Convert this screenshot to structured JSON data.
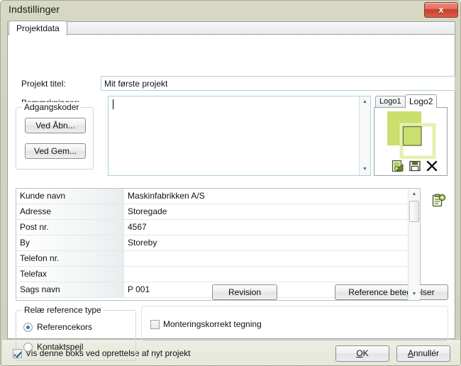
{
  "window": {
    "title": "Indstillinger",
    "close_label": "x",
    "close_icon": "close-icon"
  },
  "tabs": [
    {
      "label": "Projektdata",
      "active": true
    }
  ],
  "form": {
    "project_title_label": "Projekt titel:",
    "project_title_value": "Mit første projekt",
    "remarks_label": "Bemærkninger:",
    "remarks_value": ""
  },
  "passwords_group": {
    "title": "Adgangskoder",
    "buttons": [
      {
        "label": "Ved Åbn...",
        "name": "ved-abn-button"
      },
      {
        "label": "Ved Gem...",
        "name": "ved-gem-button"
      }
    ]
  },
  "logo_panel": {
    "tabs": [
      {
        "label": "Logo1",
        "active": false
      },
      {
        "label": "Logo2",
        "active": true
      }
    ],
    "colors": {
      "solid_square": "#cadf6e",
      "outline_square_border": "#e5f0ae",
      "overlap_outline": "#6b7a3f"
    },
    "icons": [
      {
        "name": "open-image-icon",
        "title": "open"
      },
      {
        "name": "save-icon",
        "title": "save"
      },
      {
        "name": "delete-icon",
        "title": "delete"
      }
    ]
  },
  "grid": {
    "add_icon": "add-customer-icon",
    "rows": [
      {
        "key": "Kunde navn",
        "value": "Maskinfabrikken A/S"
      },
      {
        "key": "Adresse",
        "value": "Storegade"
      },
      {
        "key": "Post nr.",
        "value": "4567"
      },
      {
        "key": "By",
        "value": "Storeby"
      },
      {
        "key": "Telefon nr.",
        "value": ""
      },
      {
        "key": "Telefax",
        "value": ""
      },
      {
        "key": "Sags navn",
        "value": "P 001"
      }
    ],
    "scrollbar": {
      "up_glyph": "▲",
      "down_glyph": "▼"
    }
  },
  "relay_group": {
    "title": "Relæ reference type",
    "options": [
      {
        "label": "Referencekors",
        "selected": true
      },
      {
        "label": "Kontaktspejl",
        "selected": false
      }
    ]
  },
  "actions": {
    "revision_label": "Revision",
    "reference_designations_label": "Reference betegnelser",
    "mounting_checkbox_label": "Monteringskorrekt tegning",
    "mounting_checked": false
  },
  "footer": {
    "show_box_label": "Vis denne boks ved oprettelse af nyt projekt",
    "show_box_checked": true,
    "ok_prefix": "O",
    "ok_suffix": "K",
    "cancel_prefix": "A",
    "cancel_suffix": "nnullér"
  }
}
